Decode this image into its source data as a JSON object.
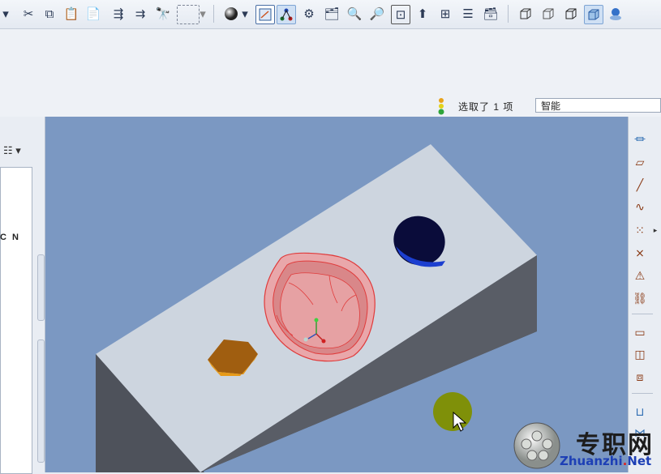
{
  "toolbar": {
    "buttons": [
      "cut-icon",
      "copy-icon",
      "paste-icon",
      "paste-special-icon",
      "regenerate-icon",
      "regenerate-manager-icon",
      "find-icon",
      "select-box-icon",
      "appearance-icon",
      "repaint-icon",
      "spin-center-icon",
      "orient-mode-icon",
      "saved-views-icon",
      "zoom-in-icon",
      "zoom-out-icon",
      "refit-icon",
      "reorient-icon",
      "view-manager-icon",
      "layers-icon",
      "model-tree-icon",
      "wireframe-icon",
      "hidden-line-icon",
      "no-hidden-icon",
      "shading-icon",
      "appearance-gallery-icon"
    ]
  },
  "status": {
    "selection": "选取了 1 项",
    "filter": "智能"
  },
  "left": {
    "tree_text": "C N"
  },
  "watermark": {
    "cn": "专职网",
    "url_prefix": "Zhuanzhi",
    "url_dot": ".",
    "url_suffix": "Net"
  },
  "colors": {
    "viewport_bg": "#7b98c2",
    "block_top": "#cdd5df",
    "block_front": "#595d66",
    "pocket_highlight": "#e03b3b",
    "hexagon": "#e79a18",
    "hole": "#0a0c3a",
    "cursor_circle": "#7f9009"
  }
}
